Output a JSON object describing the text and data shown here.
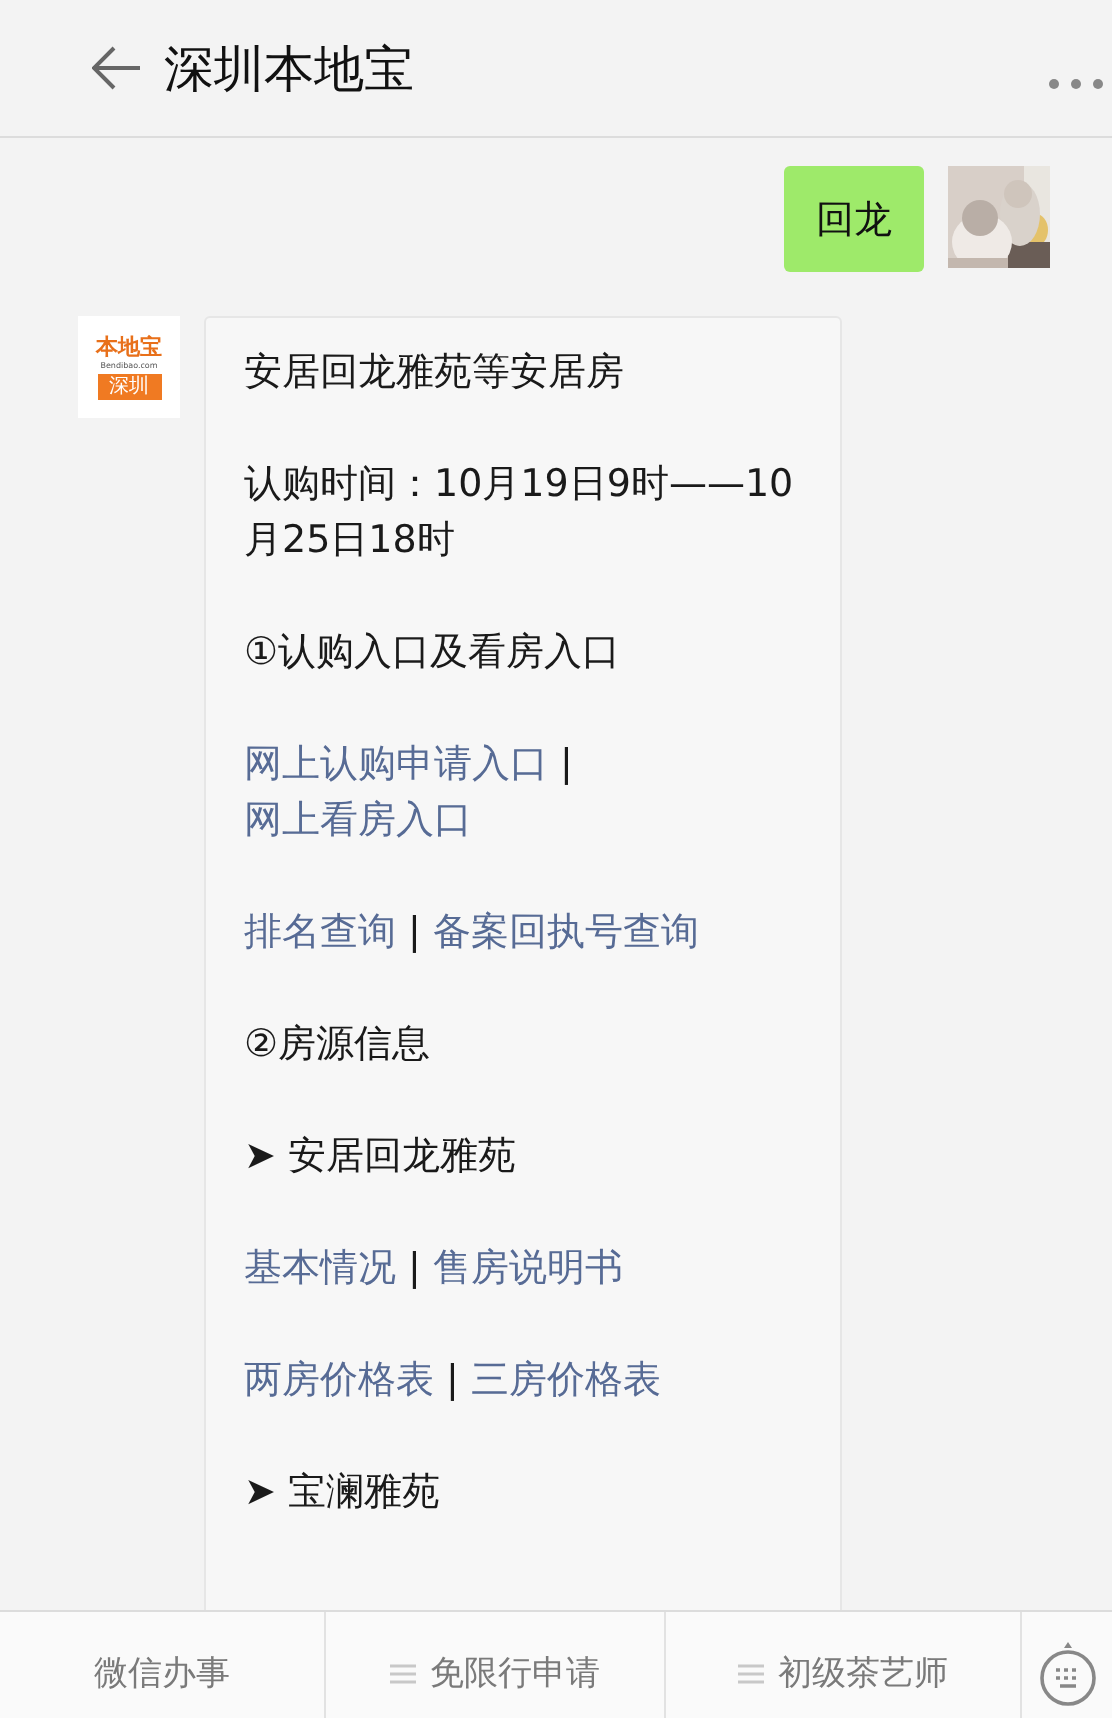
{
  "header": {
    "title": "深圳本地宝"
  },
  "messages": [
    {
      "kind": "outgoing",
      "text": "回龙"
    },
    {
      "kind": "incoming",
      "logo": {
        "brand": "本地宝",
        "site": "Bendibao.com",
        "city": "深圳"
      },
      "paragraphs": [
        {
          "kind": "text",
          "text": "安居回龙雅苑等安居房"
        },
        {
          "kind": "text",
          "text": "认购时间：10月19日9时——10月25日18时"
        },
        {
          "kind": "text",
          "text": "①认购入口及看房入口"
        },
        {
          "kind": "links",
          "parts": [
            {
              "kind": "link",
              "text": "网上认购申请入口"
            },
            {
              "kind": "sep",
              "text": "|"
            },
            {
              "kind": "link",
              "text": "网上看房入口"
            }
          ]
        },
        {
          "kind": "links",
          "parts": [
            {
              "kind": "link",
              "text": "排名查询"
            },
            {
              "kind": "sep",
              "text": "|"
            },
            {
              "kind": "link",
              "text": "备案回执号查询"
            }
          ]
        },
        {
          "kind": "text",
          "text": "②房源信息"
        },
        {
          "kind": "text",
          "text": "➤ 安居回龙雅苑"
        },
        {
          "kind": "links",
          "parts": [
            {
              "kind": "link",
              "text": "基本情况"
            },
            {
              "kind": "sep",
              "text": "|"
            },
            {
              "kind": "link",
              "text": "售房说明书"
            }
          ]
        },
        {
          "kind": "links",
          "parts": [
            {
              "kind": "link",
              "text": "两房价格表"
            },
            {
              "kind": "sep",
              "text": "|"
            },
            {
              "kind": "link",
              "text": "三房价格表"
            }
          ]
        },
        {
          "kind": "text",
          "text": "➤ 宝澜雅苑"
        }
      ]
    }
  ],
  "menu": [
    {
      "label": "微信办事",
      "submenu": false
    },
    {
      "label": "免限行申请",
      "submenu": true
    },
    {
      "label": "初级茶艺师",
      "submenu": true
    }
  ]
}
